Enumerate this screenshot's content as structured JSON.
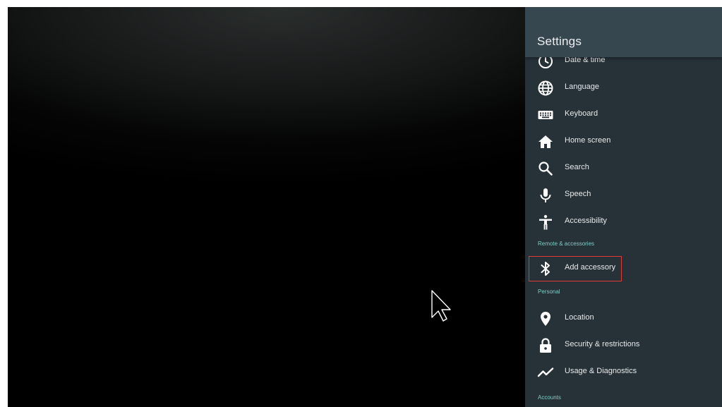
{
  "settings": {
    "title": "Settings",
    "items": {
      "date_time": "Date & time",
      "language": "Language",
      "keyboard": "Keyboard",
      "home_screen": "Home screen",
      "search": "Search",
      "speech": "Speech",
      "accessibility": "Accessibility",
      "add_accessory": "Add accessory",
      "location": "Location",
      "security": "Security & restrictions",
      "usage": "Usage & Diagnostics"
    },
    "sections": {
      "remote": "Remote & accessories",
      "personal": "Personal",
      "accounts": "Accounts"
    },
    "focused_item": "Add accessory"
  },
  "icons": {
    "date_time": "clock-icon",
    "language": "globe-icon",
    "keyboard": "keyboard-icon",
    "home_screen": "home-icon",
    "search": "search-icon",
    "speech": "microphone-icon",
    "accessibility": "accessibility-icon",
    "add_accessory": "bluetooth-icon",
    "location": "location-pin-icon",
    "security": "lock-icon",
    "usage": "trending-icon",
    "cursor": "mouse-pointer-icon"
  },
  "colors": {
    "panel_background": "#263238",
    "header_background": "#37474f",
    "section_text": "#80cbc4",
    "focus_outline": "#e53935"
  }
}
